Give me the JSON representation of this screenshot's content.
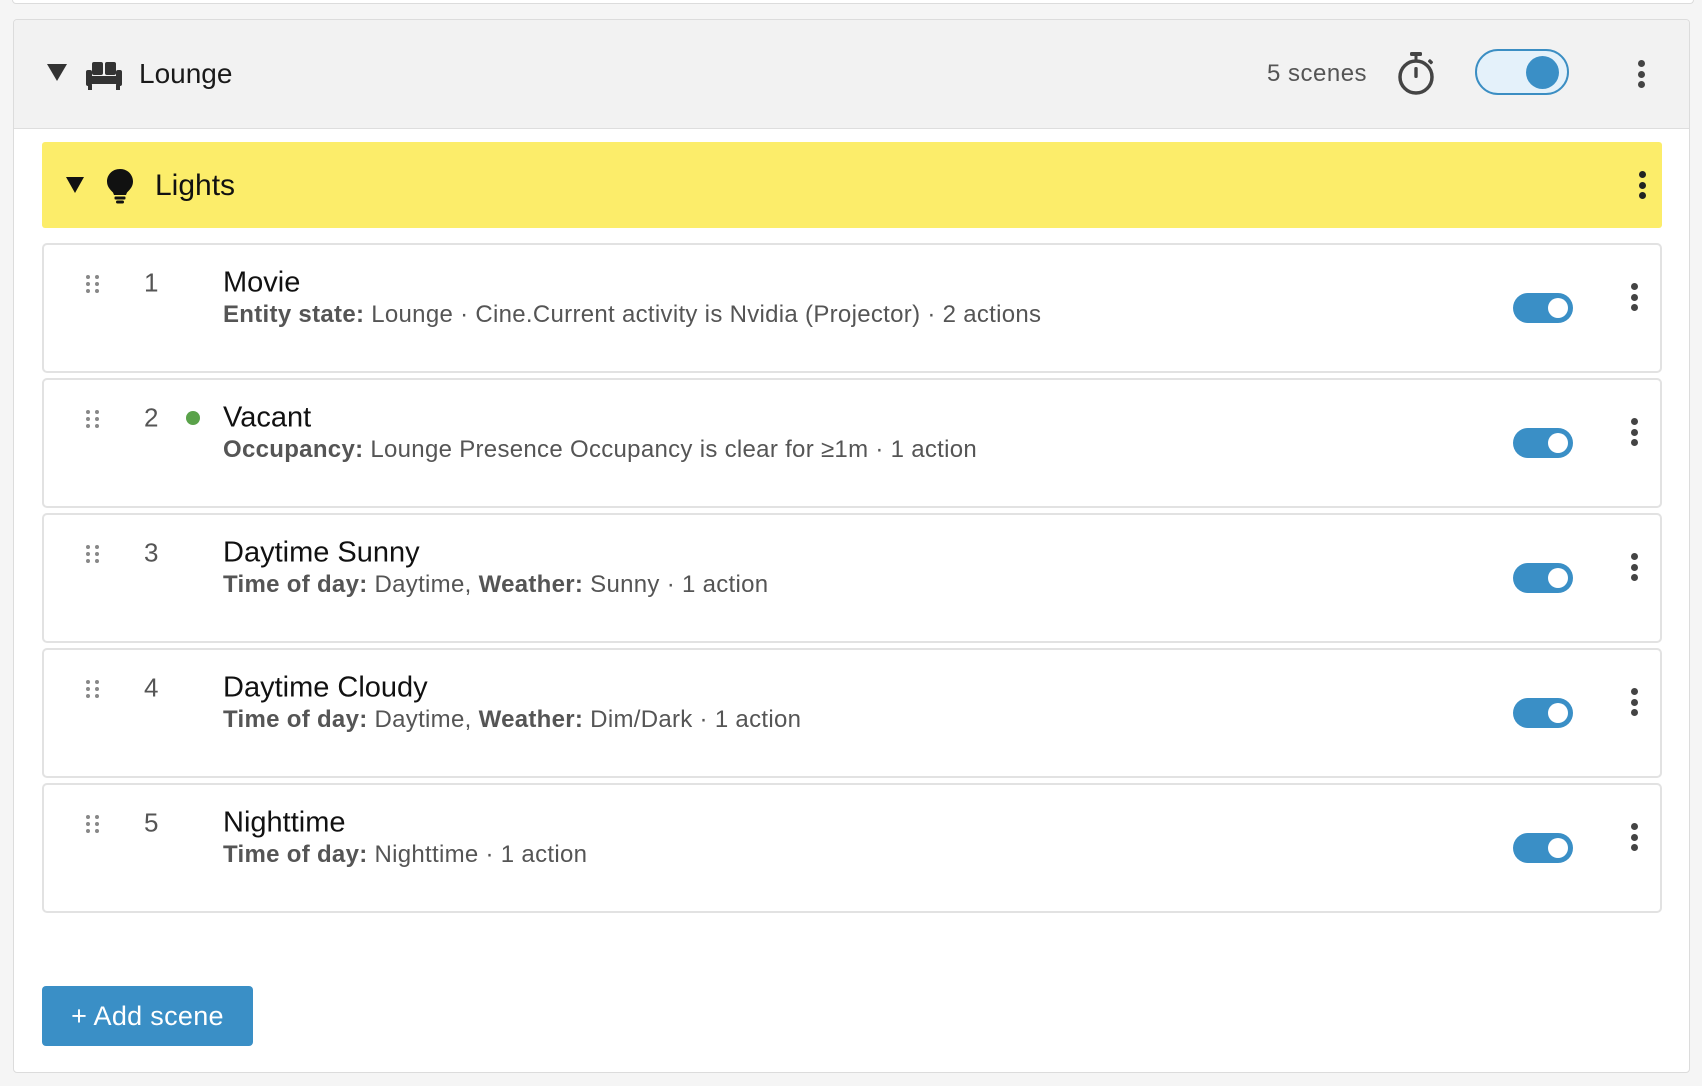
{
  "room": {
    "title": "Lounge",
    "scene_count": "5 scenes",
    "enabled": true,
    "icon": "sofa-icon"
  },
  "group": {
    "title": "Lights",
    "icon": "lightbulb-icon",
    "color": "#fced6a"
  },
  "scenes": [
    {
      "index": "1",
      "name": "Movie",
      "active": false,
      "enabled": true,
      "conditions": [
        {
          "label": "Entity state:",
          "value": " Lounge · Cine.Current activity is Nvidia (Projector)"
        }
      ],
      "actions": " · 2 actions"
    },
    {
      "index": "2",
      "name": "Vacant",
      "active": true,
      "enabled": true,
      "conditions": [
        {
          "label": "Occupancy:",
          "value": " Lounge Presence Occupancy is clear for ≥1m"
        }
      ],
      "actions": " · 1 action"
    },
    {
      "index": "3",
      "name": "Daytime Sunny",
      "active": false,
      "enabled": true,
      "conditions": [
        {
          "label": "Time of day:",
          "value": " Daytime, "
        },
        {
          "label": "Weather:",
          "value": " Sunny"
        }
      ],
      "actions": " · 1 action"
    },
    {
      "index": "4",
      "name": "Daytime Cloudy",
      "active": false,
      "enabled": true,
      "conditions": [
        {
          "label": "Time of day:",
          "value": " Daytime, "
        },
        {
          "label": "Weather:",
          "value": " Dim/Dark"
        }
      ],
      "actions": " · 1 action"
    },
    {
      "index": "5",
      "name": "Nighttime",
      "active": false,
      "enabled": true,
      "conditions": [
        {
          "label": "Time of day:",
          "value": " Nighttime"
        }
      ],
      "actions": " · 1 action"
    }
  ],
  "add_scene_label": "+ Add scene",
  "colors": {
    "accent": "#3a8fc6",
    "active_dot": "#5aa24a"
  }
}
